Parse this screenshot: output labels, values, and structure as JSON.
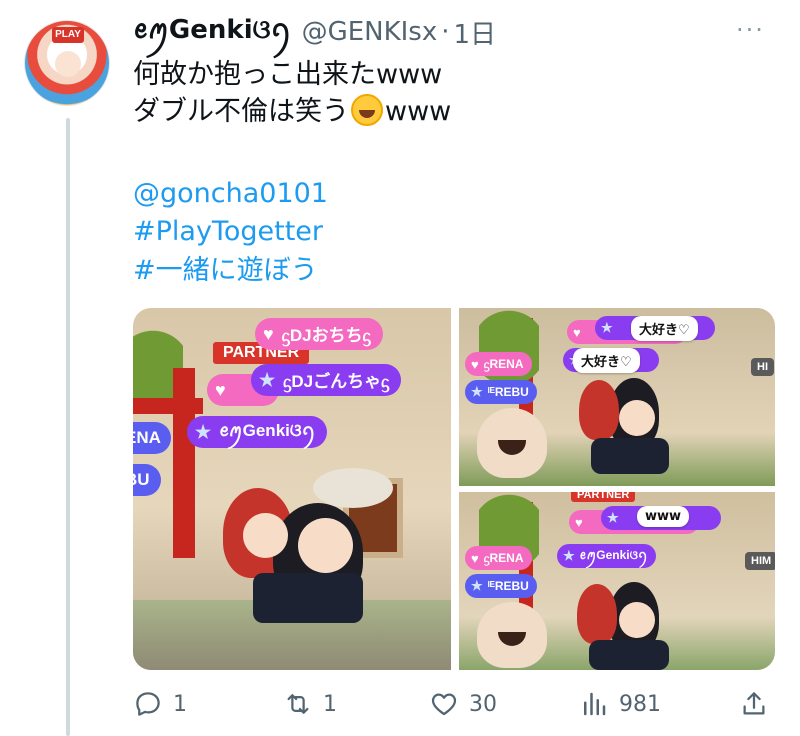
{
  "tweet": {
    "author_name": "ꫀꪑGenkiଓꪆ",
    "author_handle": "@GENKIsx",
    "separator": "·",
    "time": "1日",
    "line1": "何故か抱っこ出来たwww",
    "line2_before": "ダブル不倫は笑う",
    "line2_emoji": "rolling-on-floor-laughing-emoji",
    "line2_after": "www",
    "mention": "@goncha0101",
    "hashtag1": "#PlayTogetter",
    "hashtag2": "#一緒に遊ぼう",
    "more_label": "···"
  },
  "avatar": {
    "badge": "PLAY"
  },
  "media": {
    "main": {
      "partner": "PARTNER",
      "tag_dj_ochi": "ᦓDJおちちᦓ",
      "tag_dj_gon": "ᦓDJごんちゃᦓ",
      "tag_genki": "ꫀꪑGenkiଓꪆ",
      "tag_ena": "ENA",
      "tag_bu": "BU"
    },
    "top_right": {
      "bubble1": "大好き♡",
      "bubble2": "大好き♡",
      "tag_rena": "ᦓRENA",
      "tag_rebu": "ᴵᴱREBU",
      "chip_hi": "HI"
    },
    "bottom_right": {
      "partner": "PARTNER",
      "bubble": "www",
      "tag_rena": "ᦓRENA",
      "tag_genki": "ꫀꪑGenkiଓꪆ",
      "tag_rebu": "ᴵᴱREBU",
      "chip_him": "HIM"
    }
  },
  "actions": {
    "reply_count": "1",
    "retweet_count": "1",
    "like_count": "30",
    "views_count": "981"
  },
  "colors": {
    "link": "#1d9bf0",
    "text": "#0f1419",
    "muted": "#536471"
  }
}
